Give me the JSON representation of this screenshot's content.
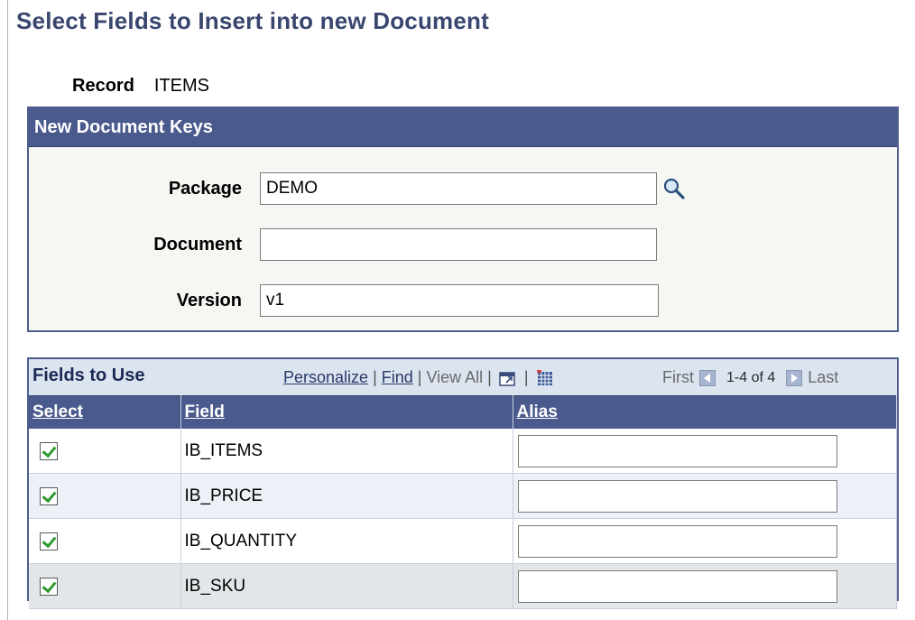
{
  "page": {
    "title": "Select Fields to Insert into new Document"
  },
  "record": {
    "label": "Record",
    "value": "ITEMS"
  },
  "keys": {
    "header": "New Document Keys",
    "package": {
      "label": "Package",
      "value": "DEMO"
    },
    "document": {
      "label": "Document",
      "value": ""
    },
    "version": {
      "label": "Version",
      "value": "v1"
    }
  },
  "grid": {
    "title": "Fields to Use",
    "personalize": "Personalize",
    "find": "Find",
    "view_all": "View All",
    "first": "First",
    "range": "1-4 of 4",
    "last": "Last",
    "columns": {
      "select": "Select",
      "field": "Field",
      "alias": "Alias"
    },
    "rows": [
      {
        "selected": true,
        "field": "IB_ITEMS",
        "alias": ""
      },
      {
        "selected": true,
        "field": "IB_PRICE",
        "alias": ""
      },
      {
        "selected": true,
        "field": "IB_QUANTITY",
        "alias": ""
      },
      {
        "selected": true,
        "field": "IB_SKU",
        "alias": ""
      }
    ]
  },
  "colors": {
    "header_bg": "#4a5a8c",
    "title": "#39466e",
    "check": "#2e9a2e"
  }
}
